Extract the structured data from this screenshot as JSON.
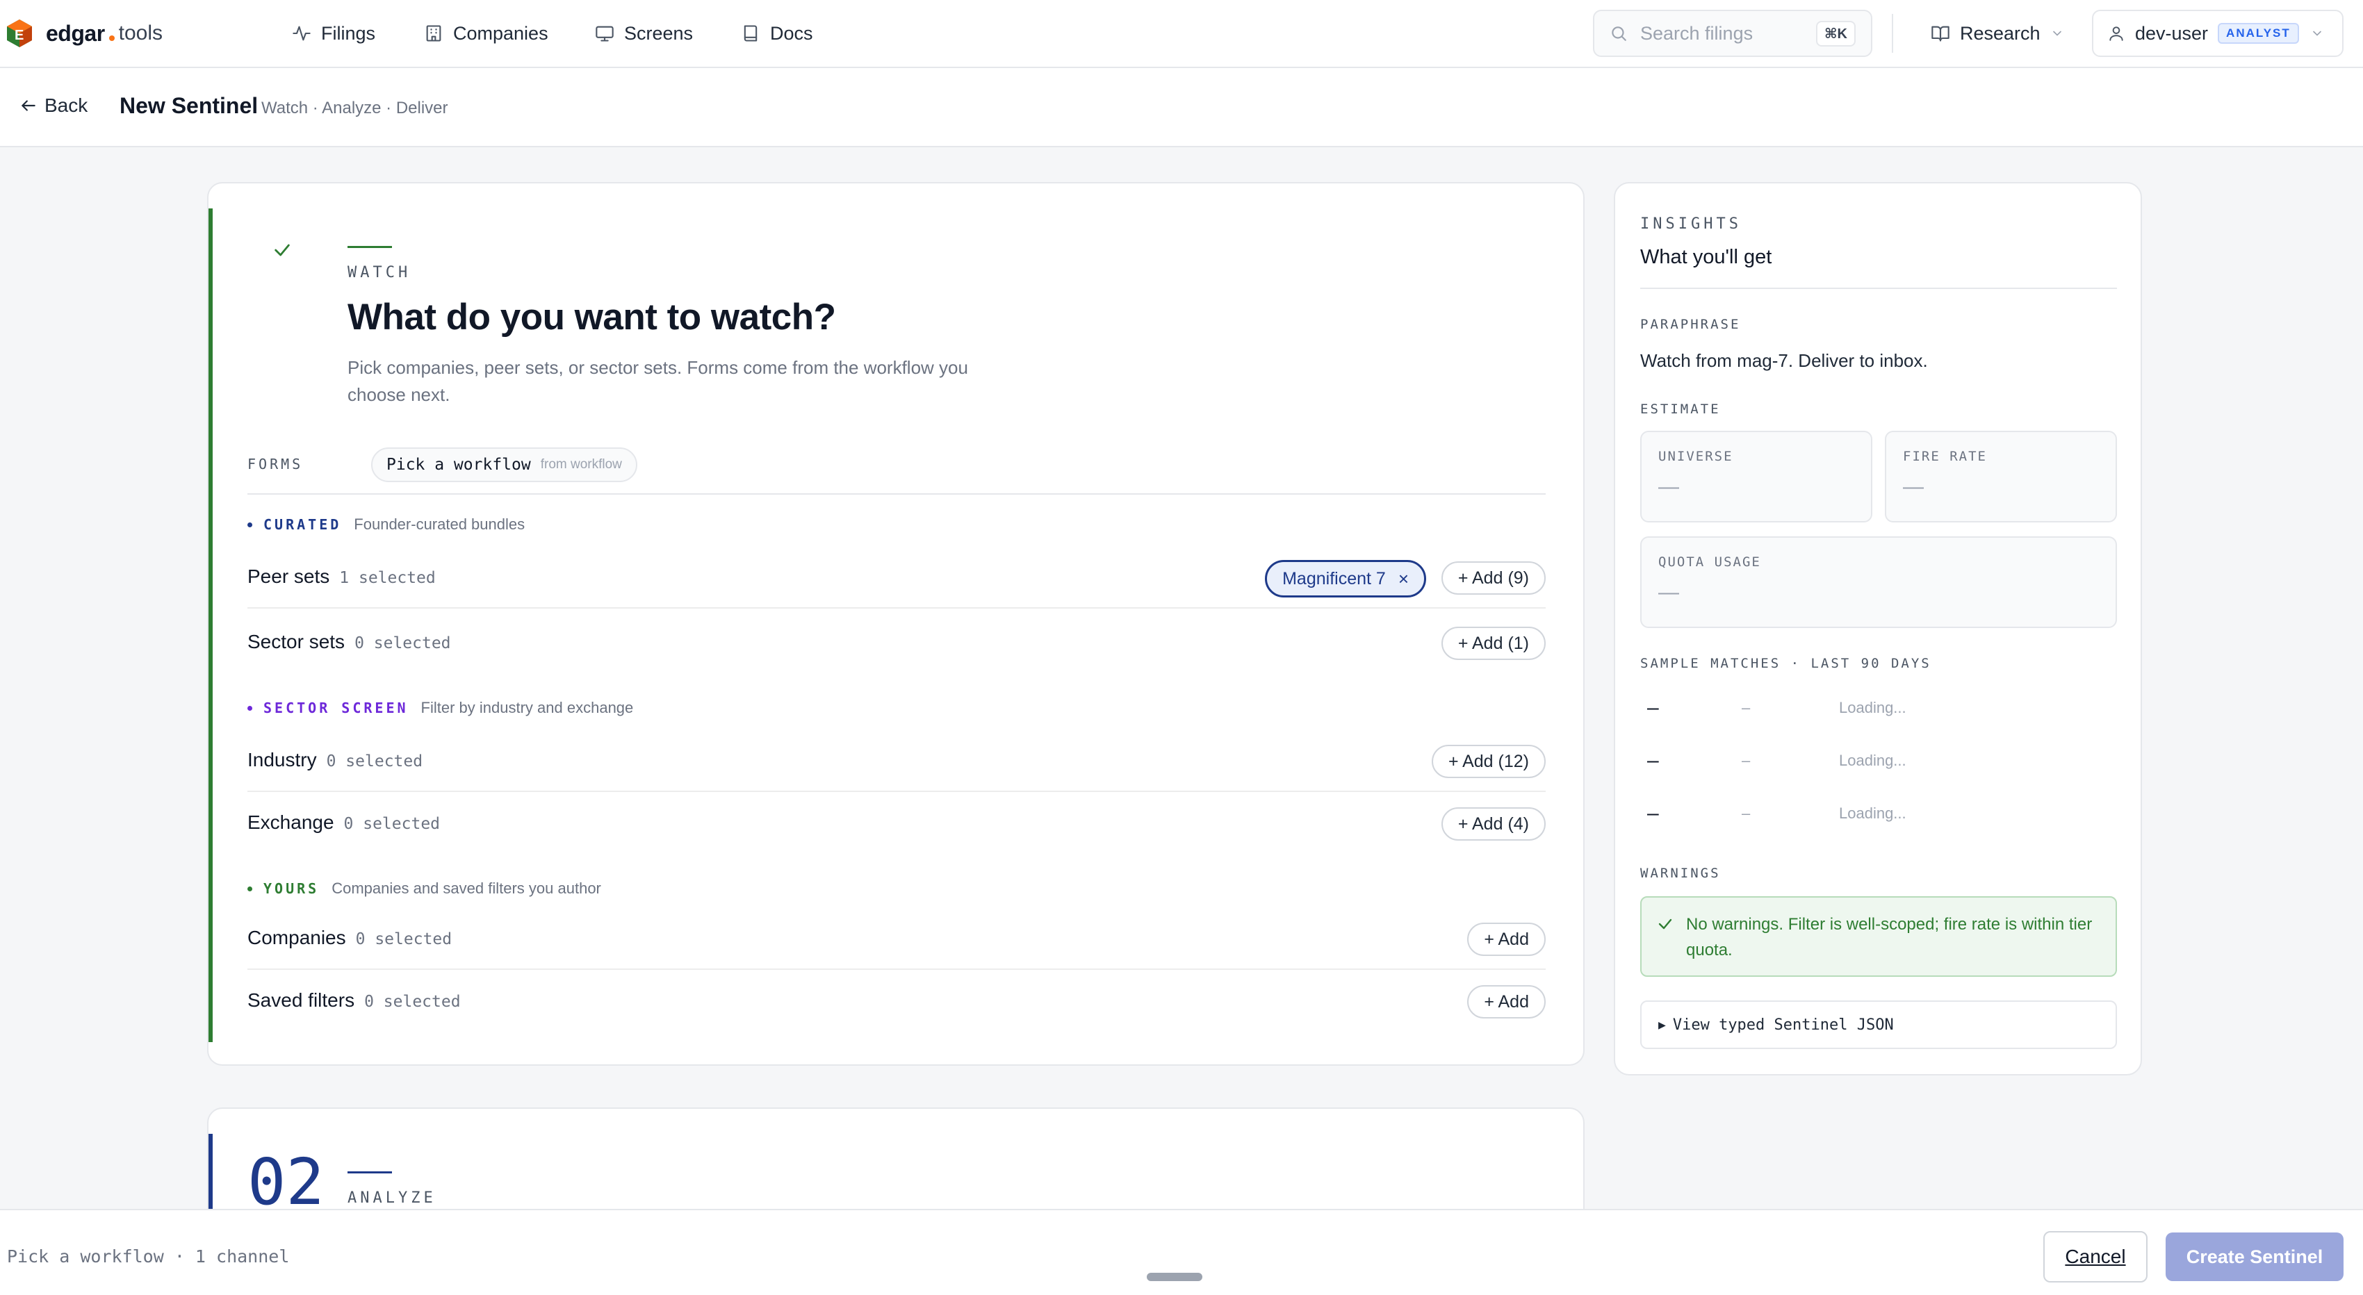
{
  "nav": {
    "logo_text": "edgar",
    "logo_suffix": "tools",
    "items": [
      {
        "label": "Filings",
        "icon": "activity-icon"
      },
      {
        "label": "Companies",
        "icon": "building-icon"
      },
      {
        "label": "Screens",
        "icon": "monitor-icon"
      },
      {
        "label": "Docs",
        "icon": "book-icon"
      }
    ],
    "search_placeholder": "Search filings",
    "search_shortcut": "⌘K",
    "research_label": "Research",
    "user_name": "dev-user",
    "user_role": "ANALYST"
  },
  "subheader": {
    "back_label": "Back",
    "title": "New Sentinel",
    "subtitle": "Watch · Analyze · Deliver"
  },
  "step1": {
    "eyebrow": "WATCH",
    "title": "What do you want to watch?",
    "description": "Pick companies, peer sets, or sector sets. Forms come from the workflow you choose next.",
    "forms_label": "FORMS",
    "forms_value": "Pick a workflow",
    "forms_source": "from workflow",
    "sections": [
      {
        "name": "CURATED",
        "desc": "Founder-curated bundles",
        "color": "#1e3a8a"
      },
      {
        "name": "SECTOR SCREEN",
        "desc": "Filter by industry and exchange",
        "color": "#6d28d9"
      },
      {
        "name": "YOURS",
        "desc": "Companies and saved filters you author",
        "color": "#2e7d32"
      }
    ],
    "rows": [
      {
        "label": "Peer sets",
        "count": "1 selected",
        "add": "+ Add (9)",
        "chip": "Magnificent 7"
      },
      {
        "label": "Sector sets",
        "count": "0 selected",
        "add": "+ Add (1)"
      },
      {
        "label": "Industry",
        "count": "0 selected",
        "add": "+ Add (12)"
      },
      {
        "label": "Exchange",
        "count": "0 selected",
        "add": "+ Add (4)"
      },
      {
        "label": "Companies",
        "count": "0 selected",
        "add": "+ Add"
      },
      {
        "label": "Saved filters",
        "count": "0 selected",
        "add": "+ Add"
      }
    ],
    "chip_remove": "×"
  },
  "step2": {
    "number": "02",
    "eyebrow": "ANALYZE"
  },
  "insights": {
    "eyebrow": "INSIGHTS",
    "title": "What you'll get",
    "paraphrase_label": "PARAPHRASE",
    "paraphrase_text": "Watch from mag-7. Deliver to inbox.",
    "estimate_label": "ESTIMATE",
    "stats": [
      {
        "label": "UNIVERSE",
        "value": "—"
      },
      {
        "label": "FIRE RATE",
        "value": "—"
      },
      {
        "label": "QUOTA USAGE",
        "value": "—"
      }
    ],
    "samples_label": "SAMPLE MATCHES · LAST 90 DAYS",
    "samples": [
      {
        "a": "–",
        "b": "–",
        "c": "Loading..."
      },
      {
        "a": "–",
        "b": "–",
        "c": "Loading..."
      },
      {
        "a": "–",
        "b": "–",
        "c": "Loading..."
      }
    ],
    "warnings_label": "WARNINGS",
    "warning_text": "No warnings. Filter is well-scoped; fire rate is within tier quota.",
    "json_toggle": "View typed Sentinel JSON"
  },
  "footer": {
    "status": "Pick a workflow · 1 channel",
    "cancel": "Cancel",
    "create": "Create Sentinel"
  }
}
